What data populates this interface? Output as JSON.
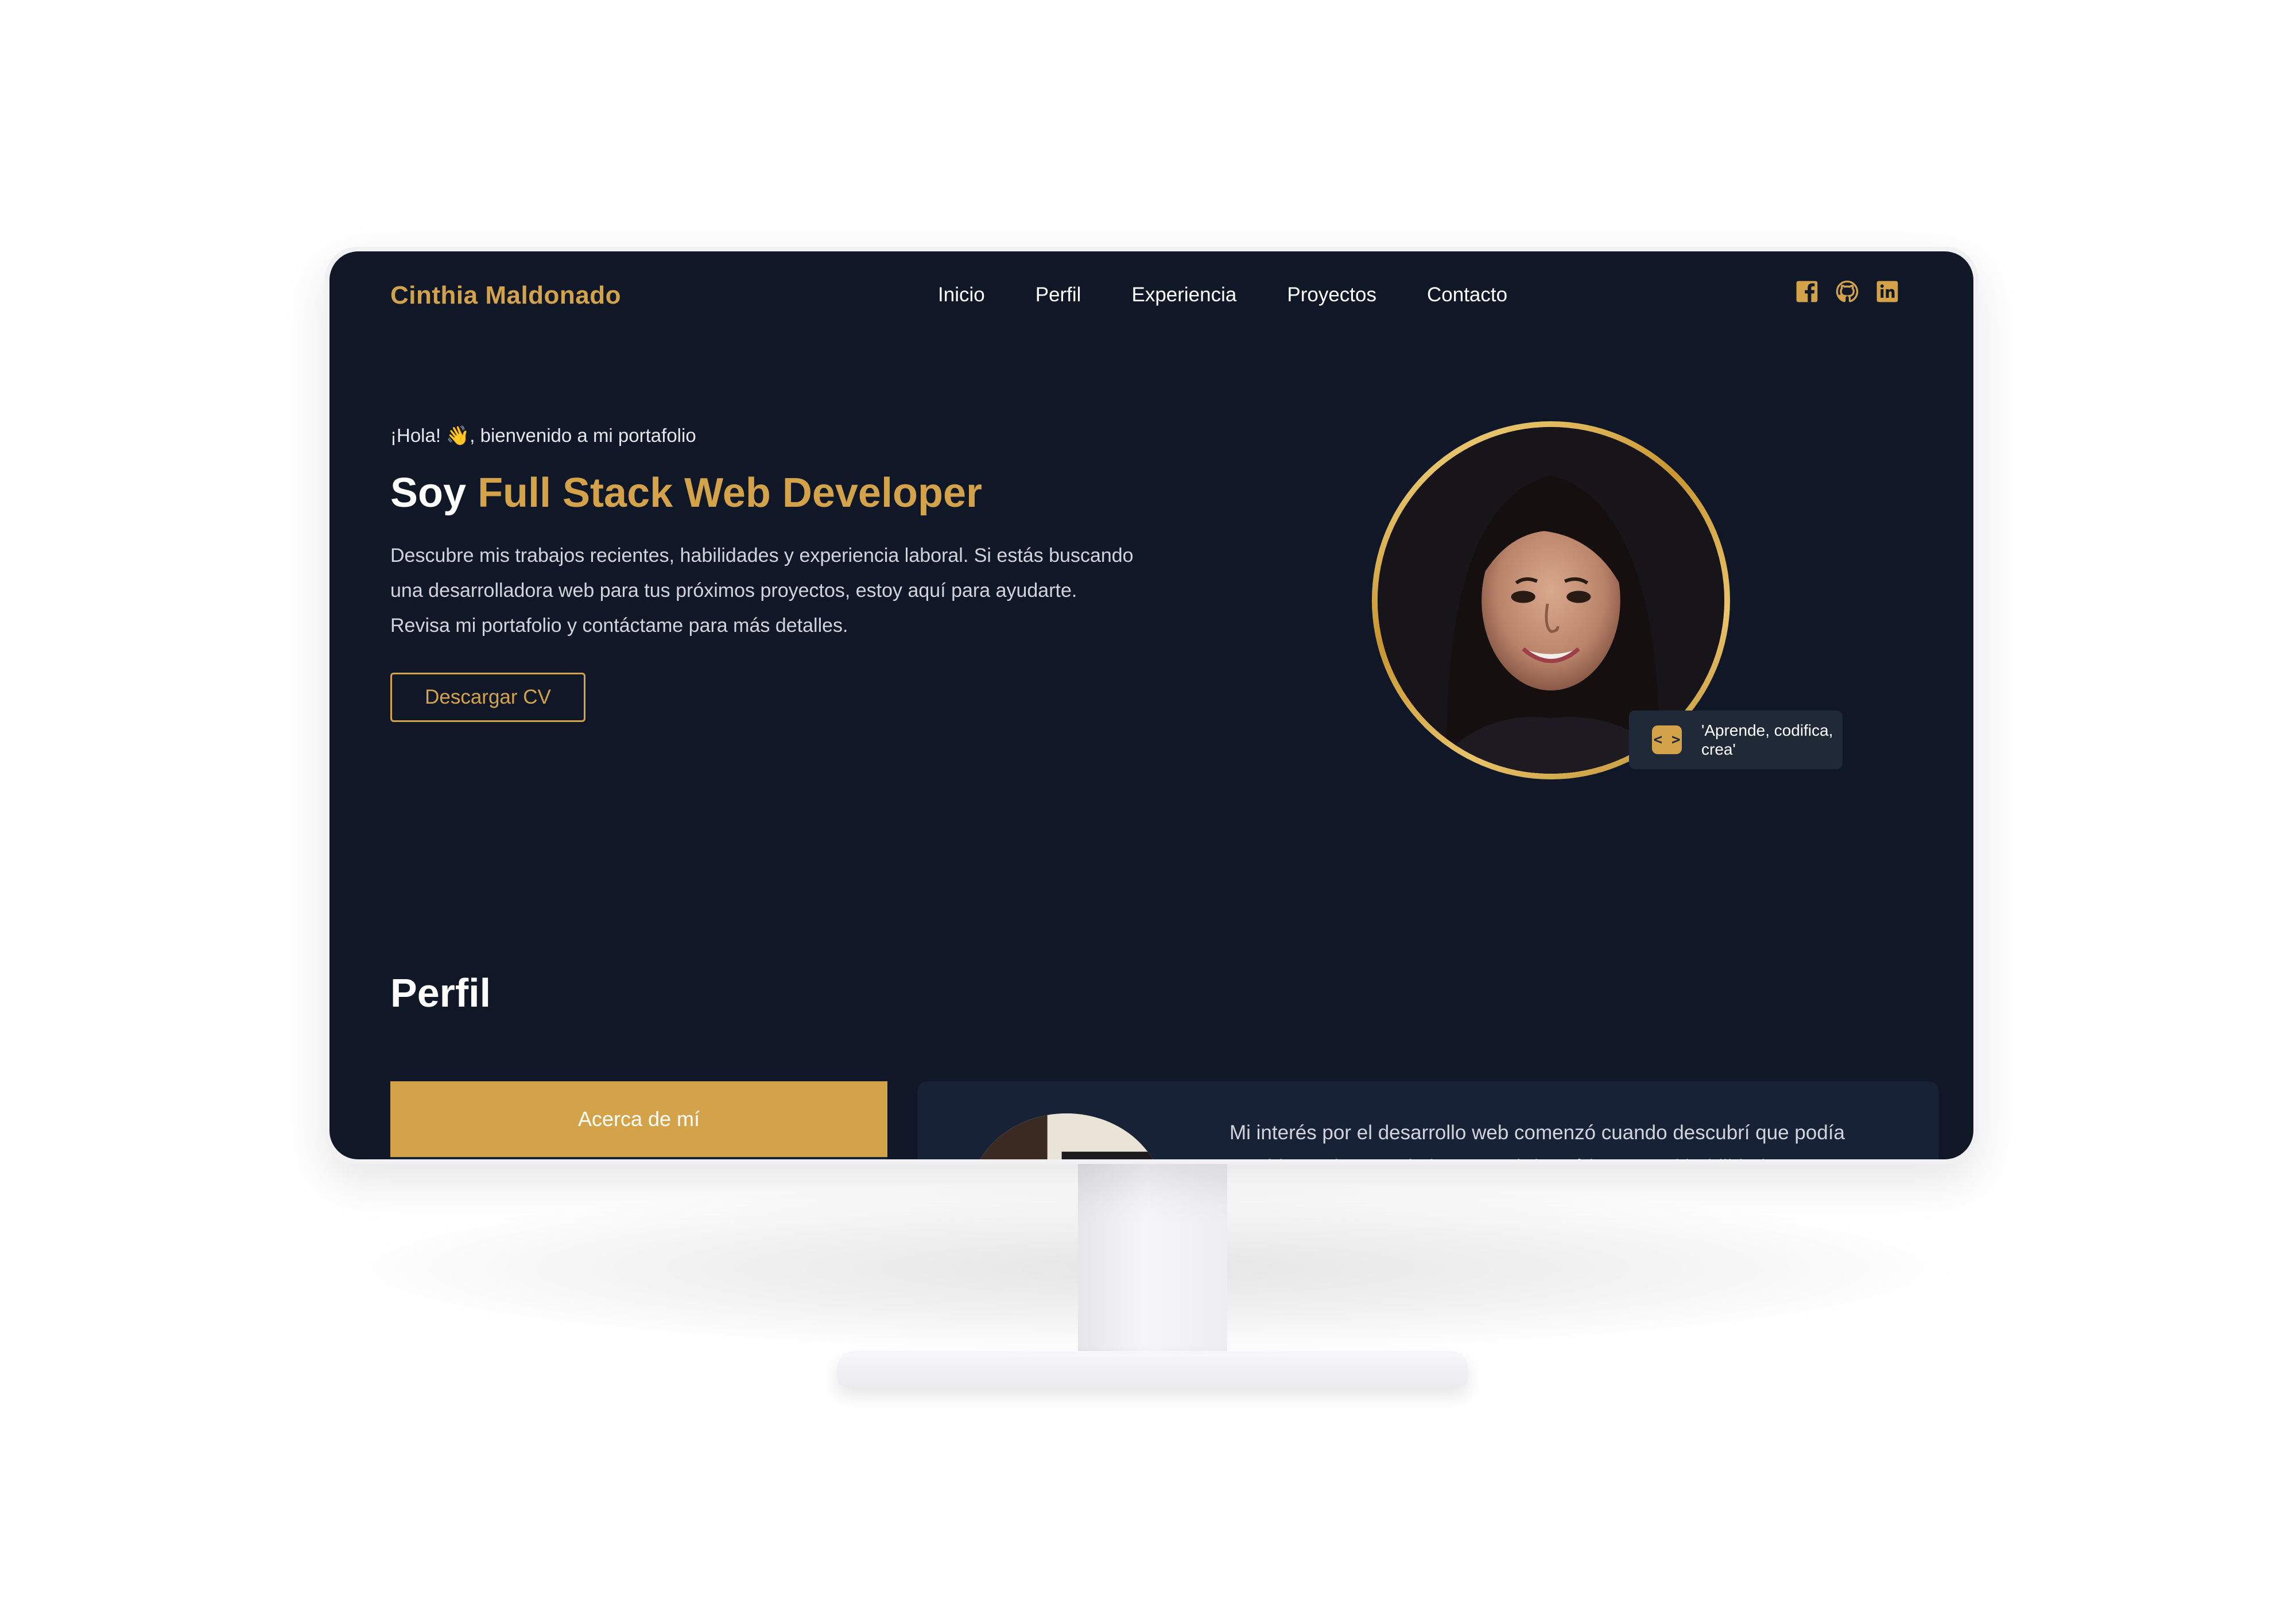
{
  "nav": {
    "brand": "Cinthia Maldonado",
    "links": [
      "Inicio",
      "Perfil",
      "Experiencia",
      "Proyectos",
      "Contacto"
    ],
    "socials": [
      "facebook-icon",
      "github-icon",
      "linkedin-icon"
    ]
  },
  "hero": {
    "greeting": "¡Hola! 👋, bienvenido a mi portafolio",
    "title_prefix": "Soy ",
    "title_accent": "Full Stack Web Developer",
    "description": "Descubre mis trabajos recientes, habilidades y experiencia laboral. Si estás buscando una desarrolladora web para tus próximos proyectos, estoy aquí para ayudarte. Revisa mi portafolio y contáctame para más detalles.",
    "cv_button": "Descargar CV",
    "quote_icon": "< >",
    "quote": "'Aprende, codifica, crea'"
  },
  "profile": {
    "title": "Perfil",
    "about_tab": "Acerca de mí",
    "about_text": "Mi interés por el desarrollo web comenzó cuando descubrí que podía combinar mis conocimientos en informática con mi habilidad para"
  },
  "colors": {
    "accent": "#d4a349",
    "background": "#101828",
    "card": "#182236"
  }
}
